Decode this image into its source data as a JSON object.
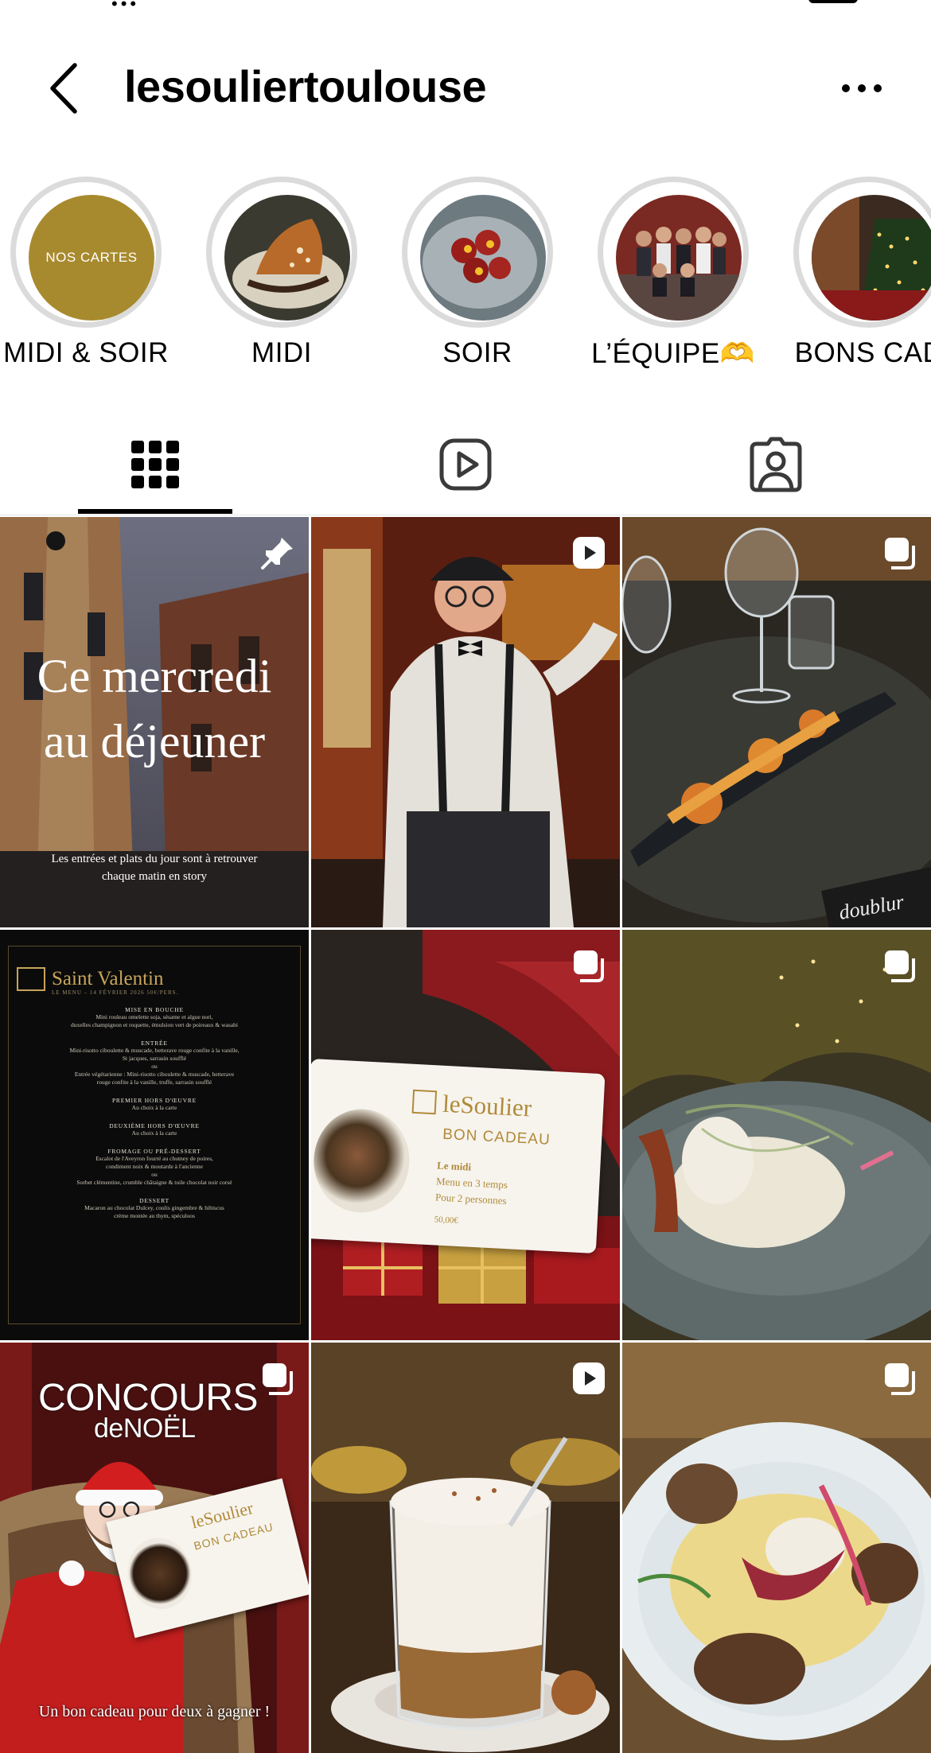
{
  "header": {
    "username": "lesouliertoulouse"
  },
  "highlights": [
    {
      "label": "MIDI & SOIR",
      "cover_text": "NOS CARTES"
    },
    {
      "label": "MIDI"
    },
    {
      "label": "SOIR"
    },
    {
      "label": "L’ÉQUIPE🫶"
    },
    {
      "label": "BONS CAD"
    }
  ],
  "tabs": [
    {
      "name": "posts",
      "icon": "grid-icon",
      "active": true
    },
    {
      "name": "reels",
      "icon": "reels-icon",
      "active": false
    },
    {
      "name": "tagged",
      "icon": "tagged-person-icon",
      "active": false
    }
  ],
  "posts": [
    {
      "type": "pinned",
      "badge": "pin-icon",
      "title_line1": "Ce mercredi",
      "title_line2": "au déjeuner",
      "caption_line1": "Les entrées et plats du jour sont à retrouver",
      "caption_line2": "chaque matin en story"
    },
    {
      "type": "reel",
      "badge": "reel-play-icon"
    },
    {
      "type": "carousel",
      "badge": "carousel-icon",
      "chalkboard_text": "doublur"
    },
    {
      "type": "image",
      "menu": {
        "title": "Saint Valentin",
        "date": "LE MENU – 14 FÉVRIER 2026    50€/PERS.",
        "sections": [
          {
            "heading": "MISE EN BOUCHE",
            "lines": [
              "Mini rouleau omelette soja, sésame et algue nori,",
              "duxelles champignon et roquette, émulsion vert de poireaux & wasabi"
            ]
          },
          {
            "heading": "ENTRÉE",
            "lines": [
              "Mini-risotto ciboulette & muscade, betterave rouge confite à la vanille,",
              "St jacques, sarrasin soufflé",
              "ou",
              "Entrée végétarienne : Mini-risotto ciboulette & muscade, betterave",
              "rouge confite à la vanille, truffe, sarrasin soufflé"
            ]
          },
          {
            "heading": "PREMIER HORS D'ŒUVRE",
            "lines": [
              "Au choix à la carte"
            ]
          },
          {
            "heading": "DEUXIÈME HORS D'ŒUVRE",
            "lines": [
              "Au choix à la carte"
            ]
          },
          {
            "heading": "FROMAGE OU PRÉ-DESSERT",
            "lines": [
              "Escalot de l'Aveyron fourré au chutney de poires,",
              "condiment noix & moutarde à l'ancienne",
              "ou",
              "Sorbet clémentine, crumble châtaigne & tuile chocolat noir corsé"
            ]
          },
          {
            "heading": "DESSERT",
            "lines": [
              "Macaron au chocolat Dulcey, coulis gingembre & hibiscus",
              "crème montée au thym, spéculoos"
            ]
          }
        ]
      }
    },
    {
      "type": "carousel",
      "badge": "carousel-icon",
      "gift_card": {
        "brand": "leSoulier",
        "subtitle": "BON CADEAU",
        "line1": "Le midi",
        "line2": "Menu en 3 temps",
        "line3": "Pour 2 personnes",
        "price": "50,00€"
      }
    },
    {
      "type": "carousel",
      "badge": "carousel-icon"
    },
    {
      "type": "carousel",
      "badge": "carousel-icon",
      "title": "CONCOURS",
      "title_sub": "deNOËL",
      "card_brand": "leSoulier",
      "card_sub": "BON CADEAU",
      "caption": "Un bon cadeau pour deux à gagner !"
    },
    {
      "type": "reel",
      "badge": "reel-play-icon"
    },
    {
      "type": "carousel",
      "badge": "carousel-icon"
    }
  ],
  "colors": {
    "text": "#000000",
    "ring": "#dbdbdb",
    "gold": "#a88a2e",
    "active_tab": "#000000",
    "inactive_icon": "#3a3a3a"
  }
}
